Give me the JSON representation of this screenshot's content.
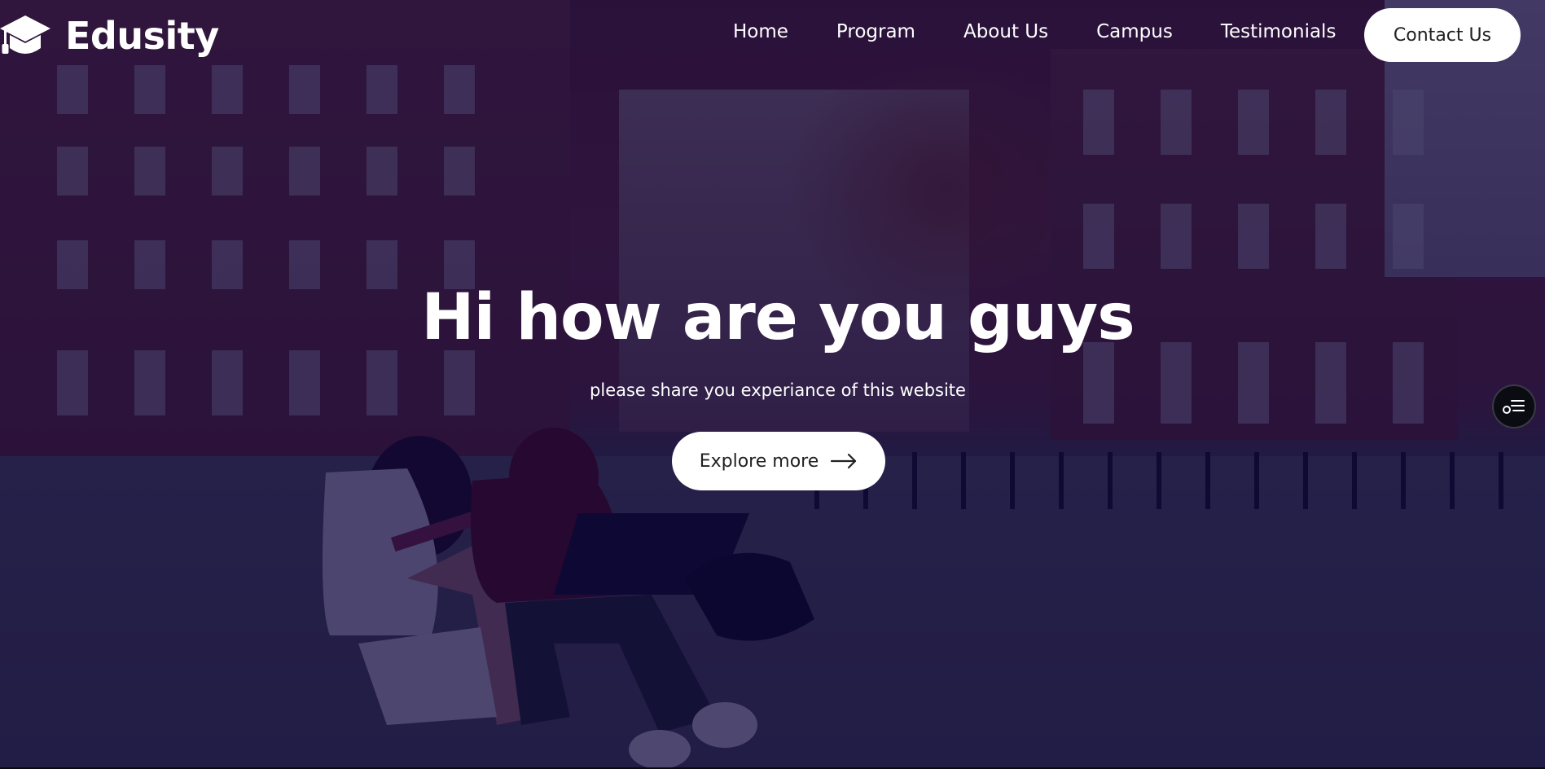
{
  "brand": {
    "name": "Edusity",
    "logo_icon": "graduation-cap-icon"
  },
  "nav": {
    "links": [
      "Home",
      "Program",
      "About Us",
      "Campus",
      "Testimonials"
    ],
    "contact_label": "Contact Us"
  },
  "hero": {
    "title": "Hi how are you guys",
    "subtitle": "please share you experiance of this website",
    "cta_label": "Explore more",
    "cta_icon": "arrow-right-icon"
  },
  "floating_widget": {
    "icon": "accessibility-menu-icon"
  },
  "colors": {
    "overlay": "#08003a",
    "button_bg": "#ffffff",
    "button_text": "#212121",
    "text": "#ffffff"
  }
}
